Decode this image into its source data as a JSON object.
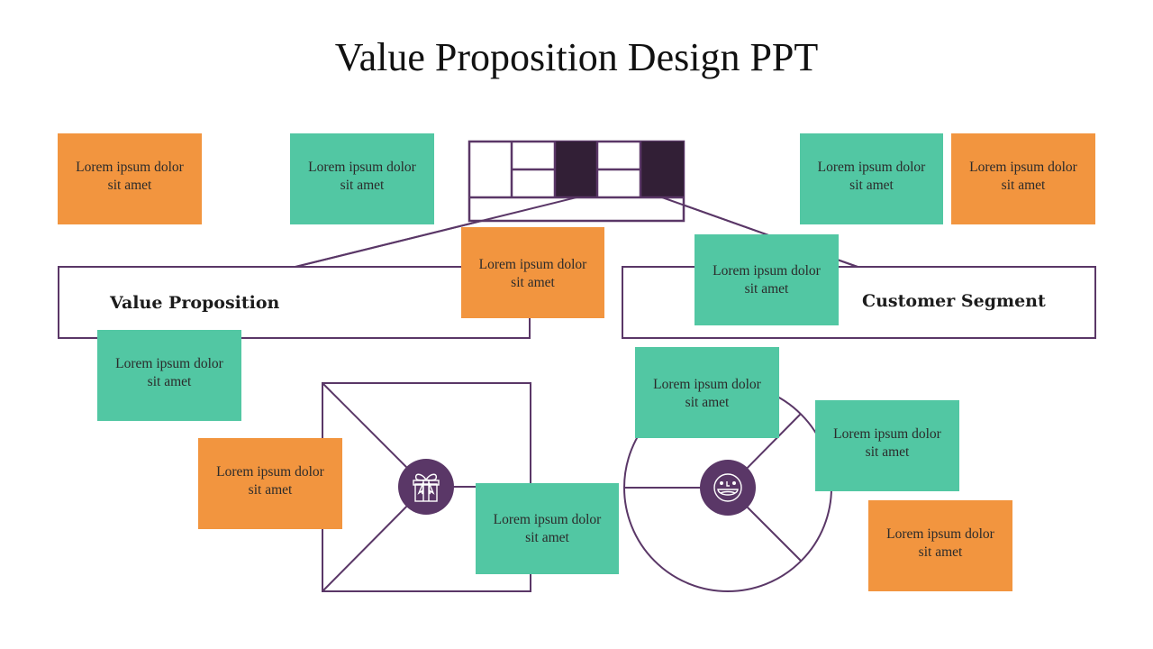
{
  "title": "Value Proposition Design PPT",
  "colors": {
    "purple": "#5a3767",
    "dark_purple": "#321f36",
    "orange": "#f2953f",
    "green": "#52c7a3"
  },
  "sections": {
    "value_proposition": "Value Proposition",
    "customer_segment": "Customer Segment"
  },
  "icons": {
    "value_icon": "gift-icon",
    "customer_icon": "smiley-face-icon"
  },
  "notes": [
    {
      "color": "orange",
      "line1": "Lorem ipsum dolor",
      "line2": "sit amet"
    },
    {
      "color": "green",
      "line1": "Lorem ipsum dolor",
      "line2": "sit amet"
    },
    {
      "color": "green",
      "line1": "Lorem ipsum dolor",
      "line2": "sit amet"
    },
    {
      "color": "orange",
      "line1": "Lorem ipsum dolor",
      "line2": "sit amet"
    },
    {
      "color": "orange",
      "line1": "Lorem ipsum dolor",
      "line2": "sit amet"
    },
    {
      "color": "green",
      "line1": "Lorem ipsum dolor",
      "line2": "sit amet"
    },
    {
      "color": "green",
      "line1": "Lorem ipsum dolor",
      "line2": "sit amet"
    },
    {
      "color": "orange",
      "line1": "Lorem ipsum dolor",
      "line2": "sit amet"
    },
    {
      "color": "green",
      "line1": "Lorem ipsum dolor",
      "line2": "sit amet"
    },
    {
      "color": "green",
      "line1": "Lorem ipsum dolor",
      "line2": "sit amet"
    },
    {
      "color": "green",
      "line1": "Lorem ipsum dolor",
      "line2": "sit amet"
    },
    {
      "color": "orange",
      "line1": "Lorem ipsum dolor",
      "line2": "sit amet"
    }
  ]
}
